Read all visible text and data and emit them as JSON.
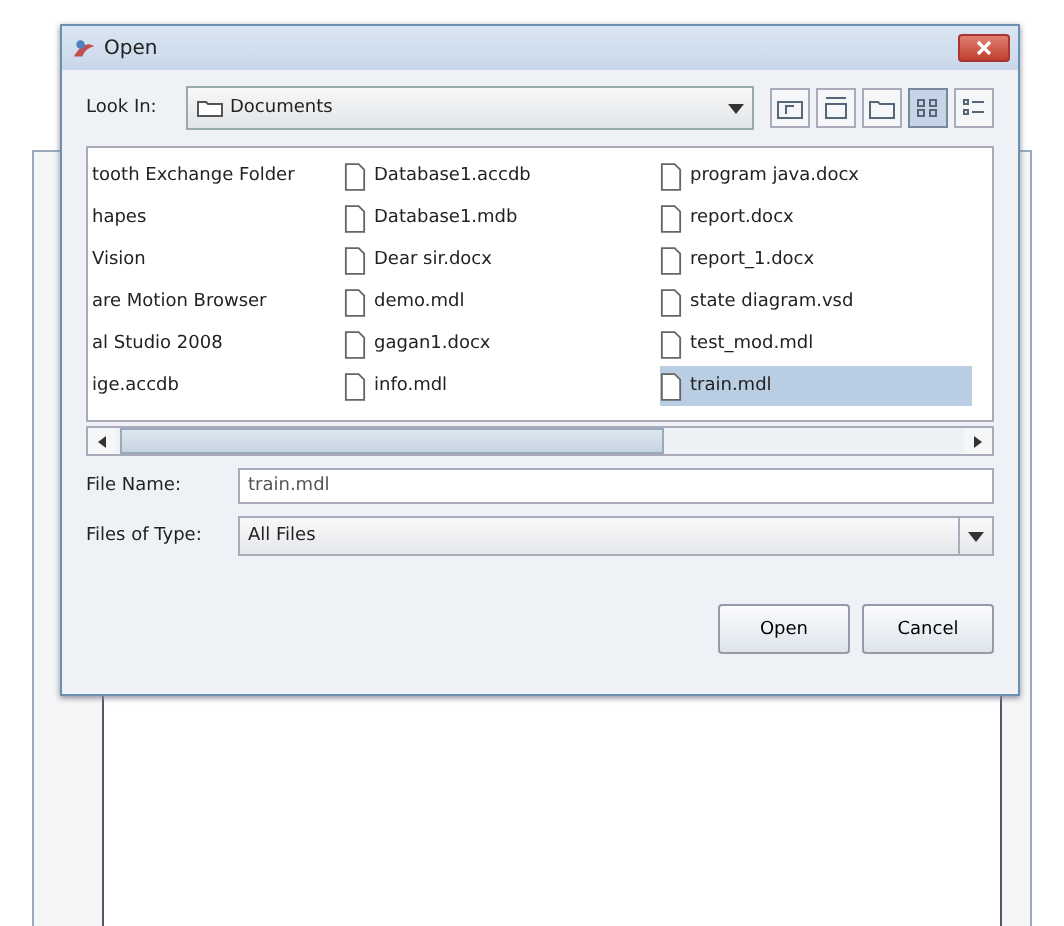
{
  "window": {
    "title": "Open"
  },
  "look_in": {
    "label": "Look In:",
    "value": "Documents"
  },
  "view_mode": {
    "list_selected": true,
    "details_selected": false
  },
  "file_list": {
    "columns": [
      {
        "items": [
          {
            "name": "tooth Exchange Folder",
            "selected": false
          },
          {
            "name": "hapes",
            "selected": false
          },
          {
            "name": "Vision",
            "selected": false
          },
          {
            "name": "are Motion Browser",
            "selected": false
          },
          {
            "name": "al Studio 2008",
            "selected": false
          },
          {
            "name": "ige.accdb",
            "selected": false
          }
        ]
      },
      {
        "items": [
          {
            "name": "Database1.accdb",
            "selected": false
          },
          {
            "name": "Database1.mdb",
            "selected": false
          },
          {
            "name": "Dear sir.docx",
            "selected": false
          },
          {
            "name": "demo.mdl",
            "selected": false
          },
          {
            "name": "gagan1.docx",
            "selected": false
          },
          {
            "name": "info.mdl",
            "selected": false
          }
        ]
      },
      {
        "items": [
          {
            "name": "program java.docx",
            "selected": false
          },
          {
            "name": "report.docx",
            "selected": false
          },
          {
            "name": "report_1.docx",
            "selected": false
          },
          {
            "name": "state diagram.vsd",
            "selected": false
          },
          {
            "name": "test_mod.mdl",
            "selected": false
          },
          {
            "name": "train.mdl",
            "selected": true
          }
        ]
      }
    ]
  },
  "file_name": {
    "label": "File Name:",
    "value": "train.mdl"
  },
  "file_type": {
    "label": "Files of Type:",
    "value": "All Files"
  },
  "buttons": [
    "Open",
    "Cancel"
  ]
}
